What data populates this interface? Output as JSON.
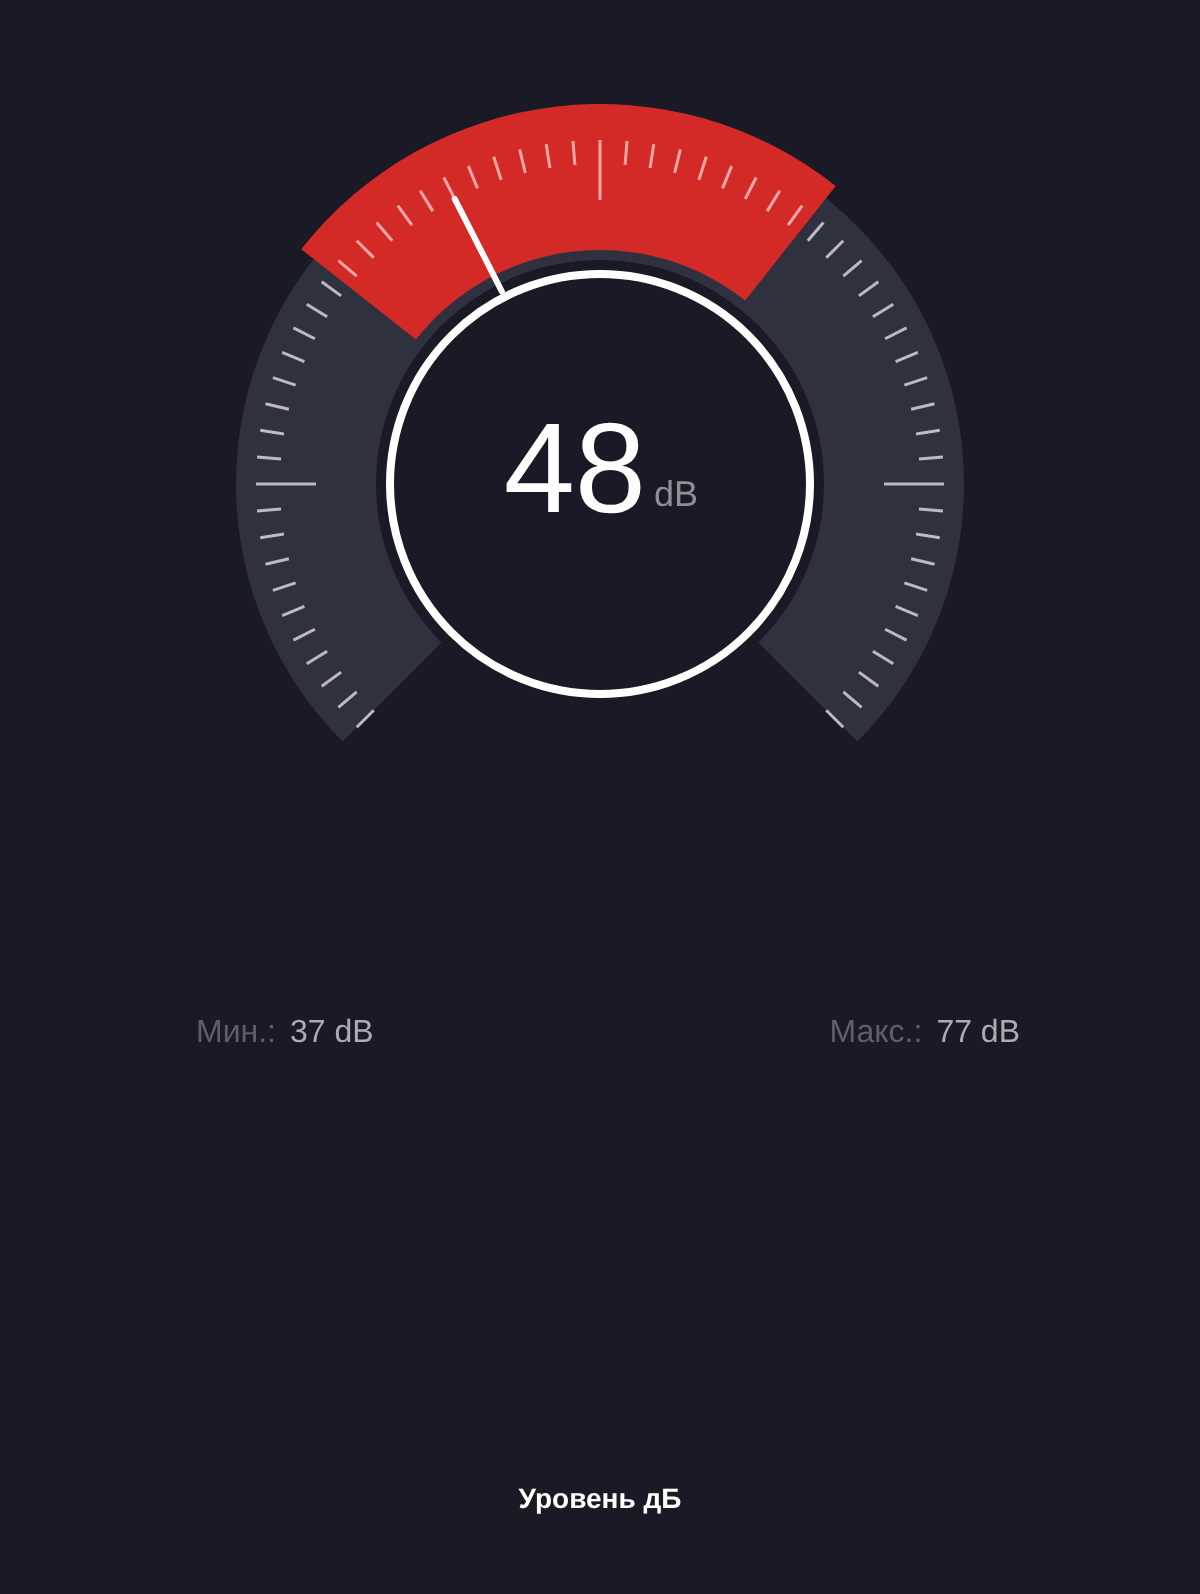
{
  "gauge": {
    "reading": "48",
    "unit": "dB"
  },
  "stats": [
    {
      "label": "Мин.:",
      "value": "37 dB"
    },
    {
      "label": "Макс.:",
      "value": "77 dB"
    }
  ],
  "footer": {
    "title": "Уровень дБ"
  }
}
